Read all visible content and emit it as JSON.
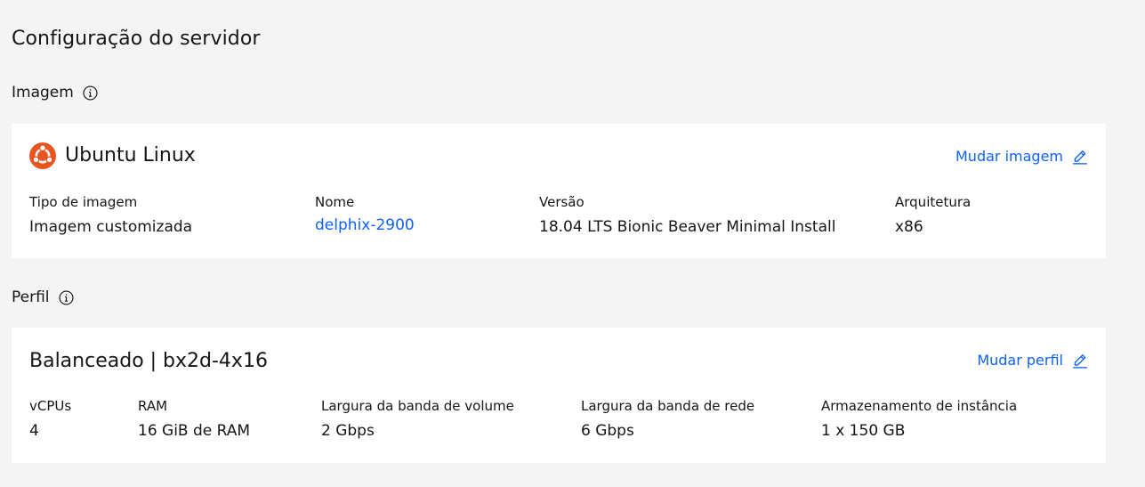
{
  "page": {
    "title": "Configuração do servidor"
  },
  "image_section": {
    "label": "Imagem",
    "card": {
      "title": "Ubuntu Linux",
      "logo_icon": "ubuntu-logo-icon",
      "action_label": "Mudar imagem",
      "action_icon": "edit-icon",
      "fields": [
        {
          "label": "Tipo de imagem",
          "value": "Imagem customizada"
        },
        {
          "label": "Nome",
          "value": "delphix-2900"
        },
        {
          "label": "Versão",
          "value": "18.04 LTS Bionic Beaver Minimal Install"
        },
        {
          "label": "Arquitetura",
          "value": "x86"
        }
      ]
    }
  },
  "profile_section": {
    "label": "Perfil",
    "card": {
      "title": "Balanceado | bx2d-4x16",
      "action_label": "Mudar perfil",
      "action_icon": "edit-icon",
      "fields": [
        {
          "label": "vCPUs",
          "value": "4"
        },
        {
          "label": "RAM",
          "value": "16 GiB de RAM"
        },
        {
          "label": "Largura da banda de volume",
          "value": "2 Gbps"
        },
        {
          "label": "Largura da banda de rede",
          "value": "6 Gbps"
        },
        {
          "label": "Armazenamento de instância",
          "value": "1 x 150 GB"
        }
      ]
    }
  },
  "colors": {
    "background": "#f4f4f4",
    "card": "#ffffff",
    "link": "#0f62fe",
    "text": "#161616",
    "ubuntu_orange": "#e95420"
  }
}
